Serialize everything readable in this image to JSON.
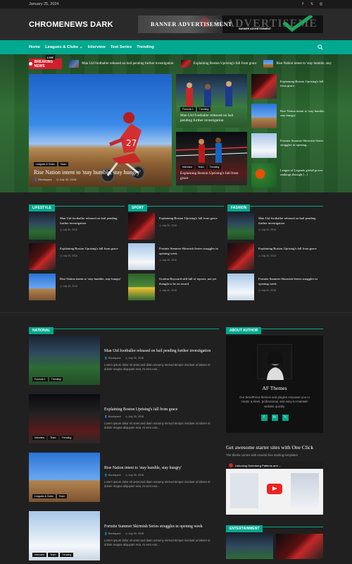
{
  "topbar": {
    "date": "January 25, 2024"
  },
  "header": {
    "logo": "CHROMENEWS DARK",
    "banner_text": "BANNER ADVERTISEMENT",
    "banner_ghost": "BANNER ADVERTISEME",
    "banner_small": "BANNER ADVERTISEMENT"
  },
  "nav": {
    "items": [
      "Home",
      "Leagues & Clubs ⌄",
      "Interview",
      "Test Series",
      "Trending"
    ]
  },
  "colors": {
    "accent": "#00a98f",
    "breaking": "#d21e2b",
    "background": "#202020"
  },
  "ticker": {
    "live": "LIVE",
    "breaking": "BREAKING NEWS",
    "items": [
      "Man Utd footballer released on bail pending further investigation",
      "Explaining Boston Uprising's fall from grace",
      "Rise Nation intent to 'stay humble, stay"
    ]
  },
  "feature": {
    "tags": [
      "Leagues & Clubs",
      "Team"
    ],
    "title": "Rise Nation intent to 'stay humble, stay hungry'",
    "author": "Blockspare",
    "date": "July 30, 2018"
  },
  "mid_cards": [
    {
      "tags": [
        "Formula 1",
        "Trending"
      ],
      "title": "Man Utd footballer released on bail pending further investigation"
    },
    {
      "tags": [
        "Interview",
        "Team",
        "Trending"
      ],
      "title": "Explaining Boston Uprising's fall from grace"
    }
  ],
  "side_list": [
    "Explaining Boston Uprising's fall from grace",
    "Rise Nation intent to 'stay humble, stay hungry'",
    "Fortnite Summer Skirmish Series struggles in opening...",
    "League of Legends global power rankings through [...]"
  ],
  "sections": [
    {
      "title": "LIFESTYLE",
      "items": [
        {
          "title": "Man Utd footballer released on bail pending further investigation",
          "date": "July 30, 2018"
        },
        {
          "title": "Explaining Boston Uprising's fall from grace",
          "date": "July 30, 2018"
        },
        {
          "title": "Rise Nation intent to 'stay humble, stay hungry'",
          "date": "July 30, 2018"
        }
      ]
    },
    {
      "title": "SPORT",
      "items": [
        {
          "title": "Explaining Boston Uprising's fall from grace",
          "date": "July 30, 2018"
        },
        {
          "title": "Fortnite Summer Skirmish Series struggles in opening week",
          "date": "July 30, 2018"
        },
        {
          "title": "Gordon Hayward still full of reports, not yet thought to be an award",
          "date": "July 30, 2018"
        }
      ]
    },
    {
      "title": "FASHION",
      "items": [
        {
          "title": "Man Utd footballer released on bail pending further investigation",
          "date": "July 30, 2018"
        },
        {
          "title": "Explaining Boston Uprising's fall from grace",
          "date": "July 30, 2018"
        },
        {
          "title": "Fortnite Summer Skirmish Series struggles in opening week",
          "date": "July 30, 2018"
        }
      ]
    }
  ],
  "national": {
    "title": "NATIONAL",
    "items": [
      {
        "tags": [
          "Formula 1",
          "Trending"
        ],
        "title": "Man Utd footballer released on bail pending further investigation",
        "author": "Blockspare",
        "date": "July 30, 2018",
        "excerpt": "Lorem ipsum dolor sit amet,sed diam nonumy eirmod tempor invidunt ut labore et dolore magna aliquyam erat, At vero eos..."
      },
      {
        "tags": [
          "Interview",
          "Team",
          "Trending"
        ],
        "title": "Explaining Boston Uprising's fall from grace",
        "author": "Blockspare",
        "date": "July 30, 2018",
        "excerpt": "Lorem ipsum dolor sit amet,sed diam nonumy eirmod tempor invidunt ut labore et dolore magna aliquyam erat, At vero eos..."
      },
      {
        "tags": [
          "Leagues & Clubs",
          "Team"
        ],
        "title": "Rise Nation intent to 'stay humble, stay hungry'",
        "author": "Blockspare",
        "date": "July 30, 2018",
        "excerpt": "Lorem ipsum dolor sit amet,sed diam nonumy eirmod tempor invidunt ut labore et dolore magna aliquyam erat, At vero eos..."
      },
      {
        "tags": [
          "Interview",
          "Team",
          "Trending"
        ],
        "title": "Fortnite Summer Skirmish Series struggles in opening week",
        "author": "Blockspare",
        "date": "July 30, 2018",
        "excerpt": "Lorem ipsum dolor sit amet,sed diam nonumy eirmod tempor invidunt ut labore et dolore magna aliquyam erat, At vero eos..."
      }
    ]
  },
  "sidebar": {
    "about_title": "ABOUT AUTHOR",
    "about_name": "AF Themes",
    "about_desc": "Our WordPress themes and plugins empower you to create a sleek, professional, and easy-to-maintain website quickly.",
    "promo_heading": "Get awesome starter sites with One Click",
    "promo_sub": "The theme comes with several free starting templates",
    "video_title": "Unboxing Gutenberg Patterns and ...",
    "entertainment_title": "ENTERTAINMENT"
  }
}
